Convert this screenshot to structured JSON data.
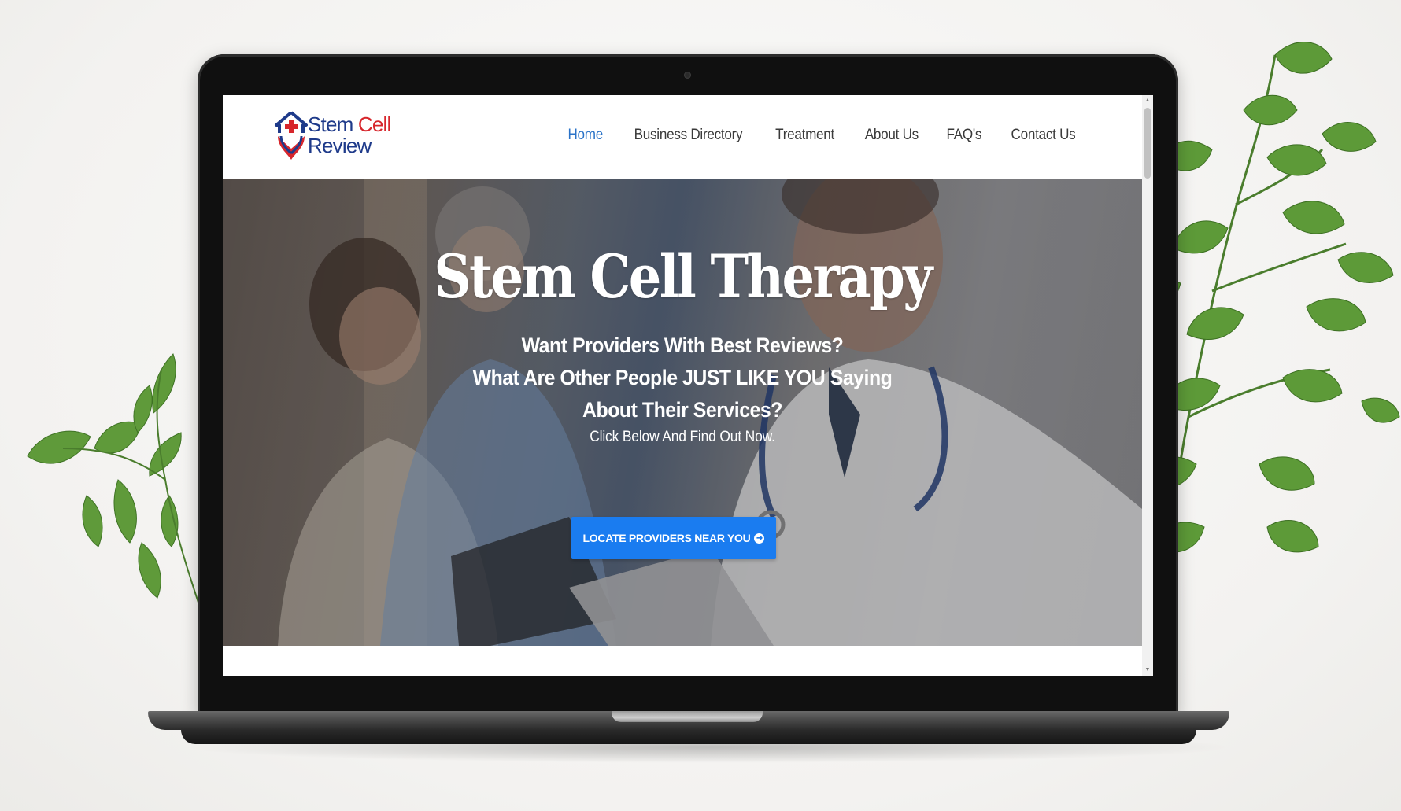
{
  "logo": {
    "word_stem": "Stem",
    "word_cell": "Cell",
    "word_review": "Review",
    "colors": {
      "navy": "#1e3a8a",
      "red": "#d7262c"
    }
  },
  "nav": {
    "items": [
      {
        "label": "Home",
        "active": true
      },
      {
        "label": "Business Directory",
        "active": false
      },
      {
        "label": "Treatment",
        "active": false
      },
      {
        "label": "About Us",
        "active": false
      },
      {
        "label": "FAQ's",
        "active": false
      },
      {
        "label": "Contact Us",
        "active": false
      }
    ],
    "active_color": "#2a73c8"
  },
  "hero": {
    "title": "Stem Cell Therapy",
    "subtitle_line1": "Want Providers With Best Reviews?",
    "subtitle_line2": "What Are Other People JUST LIKE YOU Saying",
    "subtitle_line3": "About Their Services?",
    "small_text": "Click Below And Find Out Now.",
    "cta_label": "LOCATE PROVIDERS NEAR YOU",
    "cta_icon": "arrow-circle-right-icon",
    "cta_color": "#1a7cf0"
  }
}
